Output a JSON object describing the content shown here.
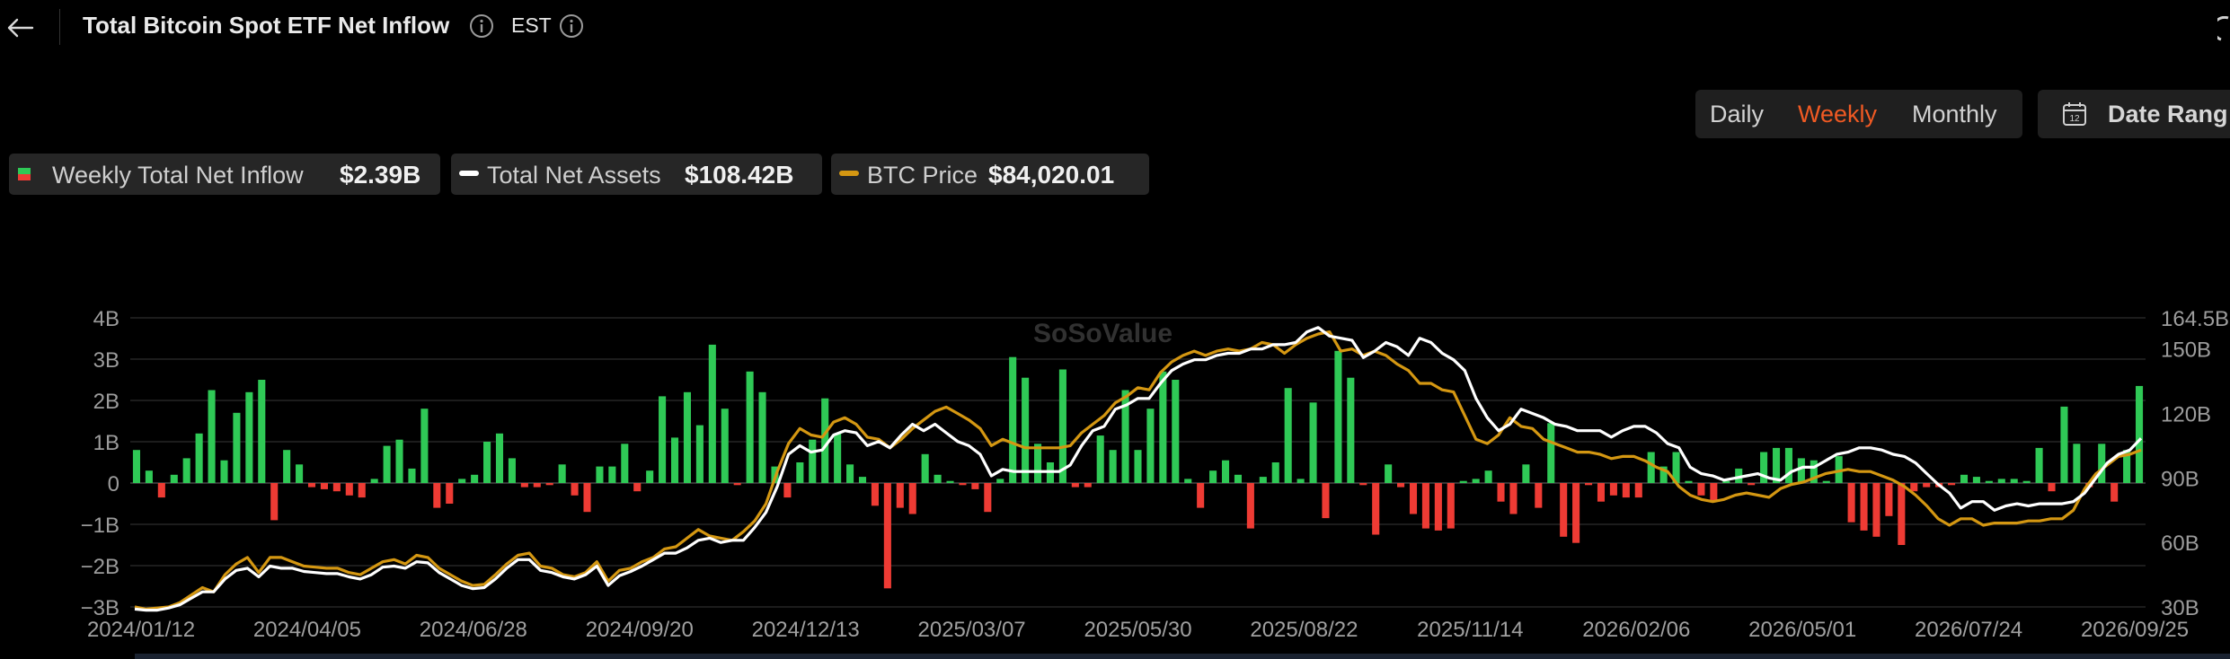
{
  "header": {
    "title": "Total Bitcoin Spot ETF Net Inflow",
    "timezone": "EST"
  },
  "period_tabs": [
    {
      "label": "Daily",
      "active": false
    },
    {
      "label": "Weekly",
      "active": true
    },
    {
      "label": "Monthly",
      "active": false
    }
  ],
  "date_range": {
    "label": "Date Rang"
  },
  "legend": {
    "inflow": {
      "label": "Weekly Total Net Inflow",
      "value": "$2.39B"
    },
    "assets": {
      "label": "Total Net Assets",
      "value": "$108.42B"
    },
    "price": {
      "label": "BTC Price",
      "value": "$84,020.01"
    }
  },
  "watermark": "SoSoValue",
  "colors": {
    "positive": "#2fc956",
    "negative": "#ee3b34",
    "assets_line": "#ffffff",
    "price_line": "#d49712",
    "active_tab": "#f05a23",
    "background": "#000000"
  },
  "icons": [
    "back-arrow-icon",
    "info-icon",
    "calendar-icon"
  ],
  "chart_data": {
    "type": "bar",
    "x_tick_labels": [
      "2024/01/12",
      "2024/04/05",
      "2024/06/28",
      "2024/09/20",
      "2024/12/13",
      "2025/03/07",
      "2025/05/30",
      "2025/08/22",
      "2025/11/14",
      "2026/02/06",
      "2026/05/01",
      "2026/07/24",
      "2026/09/25"
    ],
    "y_left": {
      "ticks": [
        "4B",
        "3B",
        "2B",
        "1B",
        "0",
        "−1B",
        "−2B",
        "−3B"
      ],
      "range": [
        -3,
        4
      ],
      "unit": "B"
    },
    "y_right": {
      "ticks": [
        "164.5B",
        "150B",
        "120B",
        "90B",
        "60B",
        "30B"
      ],
      "range": [
        30,
        164.5
      ],
      "unit": "B"
    },
    "grid": true,
    "series": [
      {
        "name": "Weekly Total Net Inflow",
        "type": "bar",
        "unit": "B USD",
        "values": [
          0.8,
          0.3,
          -0.35,
          0.2,
          0.6,
          1.2,
          2.25,
          0.55,
          1.7,
          2.2,
          2.5,
          -0.9,
          0.8,
          0.45,
          -0.1,
          -0.15,
          -0.2,
          -0.3,
          -0.35,
          0.1,
          0.9,
          1.05,
          0.35,
          1.8,
          -0.6,
          -0.5,
          0.1,
          0.2,
          1.0,
          1.2,
          0.6,
          -0.1,
          -0.1,
          -0.05,
          0.45,
          -0.3,
          -0.7,
          0.4,
          0.4,
          0.95,
          -0.2,
          0.3,
          2.1,
          1.1,
          2.2,
          1.4,
          3.35,
          1.8,
          -0.05,
          2.7,
          2.2,
          0.4,
          -0.35,
          0.5,
          1.05,
          2.05,
          1.2,
          0.45,
          0.15,
          -0.55,
          -2.55,
          -0.6,
          -0.75,
          0.7,
          0.2,
          0.05,
          -0.05,
          -0.15,
          -0.7,
          0.1,
          3.05,
          2.55,
          0.95,
          0.5,
          2.75,
          -0.1,
          -0.1,
          1.15,
          0.8,
          2.25,
          0.8,
          1.8,
          2.7,
          2.5,
          0.1,
          -0.6,
          0.3,
          0.55,
          0.2,
          -1.1,
          0.15,
          0.5,
          2.3,
          0.1,
          1.95,
          -0.85,
          3.2,
          2.55,
          -0.05,
          -1.25,
          0.45,
          -0.1,
          -0.75,
          -1.1,
          -1.15,
          -1.1,
          0.05,
          0.1,
          0.3,
          -0.45,
          -0.75,
          0.45,
          -0.6,
          1.45,
          -1.3,
          -1.45,
          -0.05,
          -0.45,
          -0.3,
          -0.35,
          -0.35,
          0.75,
          0.4,
          0.75,
          0.05,
          -0.3,
          -0.45,
          0.05,
          0.35,
          -0.05,
          0.75,
          0.85,
          0.85,
          0.6,
          0.55,
          0.05,
          0.65,
          -0.95,
          -1.15,
          -1.3,
          -0.8,
          -1.5,
          -0.2,
          -0.1,
          -0.1,
          -0.05,
          0.2,
          0.15,
          0.05,
          0.1,
          0.1,
          0.05,
          0.85,
          -0.2,
          1.85,
          0.95,
          -0.1,
          0.95,
          -0.45,
          0.8,
          2.35
        ]
      },
      {
        "name": "Total Net Assets",
        "type": "line",
        "unit": "B USD",
        "values": [
          29,
          28.5,
          28.5,
          29.5,
          31,
          34,
          37,
          37,
          43,
          47,
          48,
          44,
          49,
          48,
          48,
          46.5,
          46,
          45.5,
          45.5,
          44,
          43,
          45,
          48.5,
          49,
          48,
          51,
          50.5,
          46,
          43,
          40,
          38.5,
          39,
          43,
          48,
          52,
          52,
          47,
          46,
          44,
          43,
          45,
          49,
          40,
          44.5,
          46.5,
          49,
          52,
          55,
          55,
          57.5,
          61,
          62,
          60,
          61,
          61,
          67,
          74,
          86,
          101,
          105,
          102,
          103,
          110,
          112,
          111,
          105,
          107,
          104,
          110,
          115,
          112,
          115,
          111,
          107,
          105,
          101,
          91,
          94,
          93,
          93,
          93,
          93,
          93,
          96,
          105,
          112,
          114,
          122,
          124,
          127,
          127,
          134,
          140,
          143,
          145,
          145,
          147,
          148,
          148,
          150,
          150,
          152,
          152,
          153,
          158,
          160,
          156,
          155,
          154,
          146,
          149,
          153,
          151,
          147,
          155,
          153,
          148,
          145,
          140,
          127,
          118,
          112,
          115,
          122,
          120,
          118,
          115,
          114,
          112,
          112,
          112,
          109,
          112,
          114,
          114,
          111,
          106,
          104,
          95,
          92,
          91,
          89,
          90,
          91,
          92,
          90,
          89,
          93,
          95,
          95,
          98,
          101,
          102,
          104,
          104,
          103,
          101,
          100,
          97,
          92,
          87,
          83,
          76,
          79,
          79,
          75,
          77,
          78,
          77,
          78,
          78,
          78,
          79,
          83,
          90,
          97,
          101,
          103,
          108.42
        ]
      },
      {
        "name": "BTC Price",
        "type": "line",
        "unit": "B USD (right-axis scale)",
        "values": [
          30,
          29,
          29.5,
          30,
          32,
          35.5,
          39,
          37,
          45,
          50,
          53,
          46,
          53,
          53,
          51,
          49,
          48.5,
          48,
          48,
          46,
          45,
          48,
          51,
          52,
          50,
          54,
          53,
          48,
          45,
          42,
          40,
          40.5,
          45,
          50,
          54,
          55,
          49,
          48,
          45,
          44,
          46,
          51,
          42,
          47,
          48,
          51,
          53,
          57,
          58,
          62,
          66,
          63,
          62,
          61,
          65,
          70,
          78,
          93,
          106,
          113,
          110,
          109,
          116,
          118,
          115,
          109,
          108,
          104,
          108,
          113,
          117,
          121,
          123,
          120,
          117,
          113,
          105,
          108,
          106,
          104,
          104,
          104,
          104,
          105,
          111,
          115,
          119,
          125,
          128,
          132,
          131,
          139,
          144,
          147,
          149,
          147,
          149,
          150,
          149,
          150,
          153,
          152,
          148,
          152,
          155,
          157,
          158,
          149,
          150,
          147,
          149,
          147,
          143,
          140,
          134,
          134,
          131,
          130,
          119,
          108,
          106,
          110,
          118,
          114,
          113,
          108,
          106,
          104,
          102,
          102,
          101,
          99,
          100,
          100,
          98,
          95,
          93,
          86,
          82,
          80,
          79,
          80,
          82,
          83,
          82,
          81,
          85,
          87,
          88,
          90,
          92,
          93,
          94,
          93,
          93,
          91,
          89,
          86,
          82,
          77,
          71,
          68,
          71,
          71,
          68,
          69,
          69,
          69,
          70,
          70,
          71,
          71,
          75,
          85,
          92,
          96,
          100,
          101,
          103
        ]
      }
    ]
  }
}
